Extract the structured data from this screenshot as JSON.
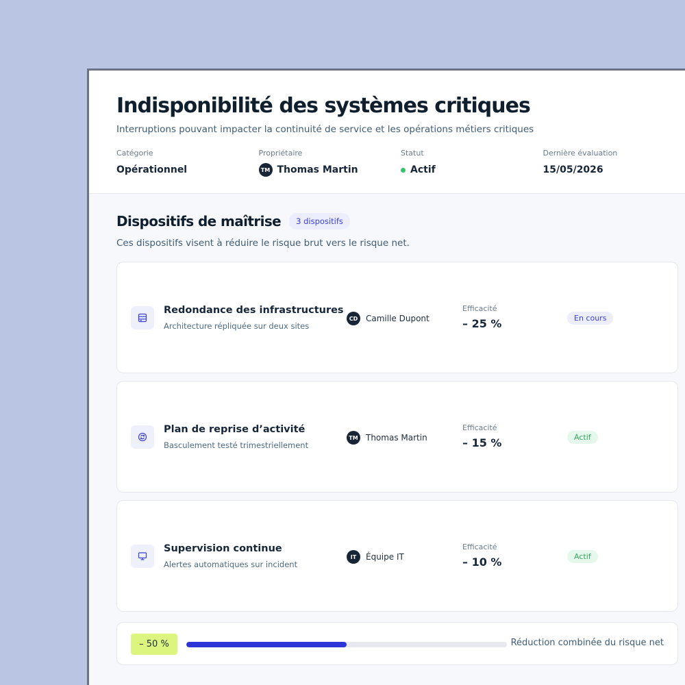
{
  "header": {
    "title": "Indisponibilité des systèmes critiques",
    "subtitle": "Interruptions pouvant impacter la continuité de service et les opérations métiers critiques",
    "meta": {
      "category_label": "Catégorie",
      "category_value": "Opérationnel",
      "owner_label": "Propriétaire",
      "owner_initials": "TM",
      "owner_value": "Thomas Martin",
      "status_label": "Statut",
      "status_value": "Actif",
      "evaluation_label": "Dernière évaluation",
      "evaluation_value": "15/05/2026"
    }
  },
  "controls": {
    "title": "Dispositifs de maîtrise",
    "count_badge": "3 dispositifs",
    "description": "Ces dispositifs visent à réduire le risque brut vers le risque net.",
    "efficacy_label": "Efficacité",
    "items": [
      {
        "icon": "server-icon",
        "title": "Redondance des infrastructures",
        "description": "Architecture répliquée sur deux sites",
        "owner_initials": "CD",
        "owner": "Camille Dupont",
        "efficacy": "– 25 %",
        "status": "En cours",
        "status_color": "#3a3fd8"
      },
      {
        "icon": "refresh-icon",
        "title": "Plan de reprise d’activité",
        "description": "Basculement testé trimestriellement",
        "owner_initials": "TM",
        "owner": "Thomas Martin",
        "efficacy": "– 15 %",
        "status": "Actif",
        "status_color": "#33a860"
      },
      {
        "icon": "monitor-icon",
        "title": "Supervision continue",
        "description": "Alertes automatiques sur incident",
        "owner_initials": "IT",
        "owner": "Équipe IT",
        "efficacy": "– 10 %",
        "status": "Actif",
        "status_color": "#33a860"
      }
    ]
  },
  "summary": {
    "reduction_badge": "– 50 %",
    "progress_fraction": 0.5,
    "label": "Réduction combinée du risque net"
  },
  "colors": {
    "background": "#b9c5e2",
    "accent": "#2d35d6",
    "highlight": "#dcf57e",
    "active": "#35c46a"
  }
}
